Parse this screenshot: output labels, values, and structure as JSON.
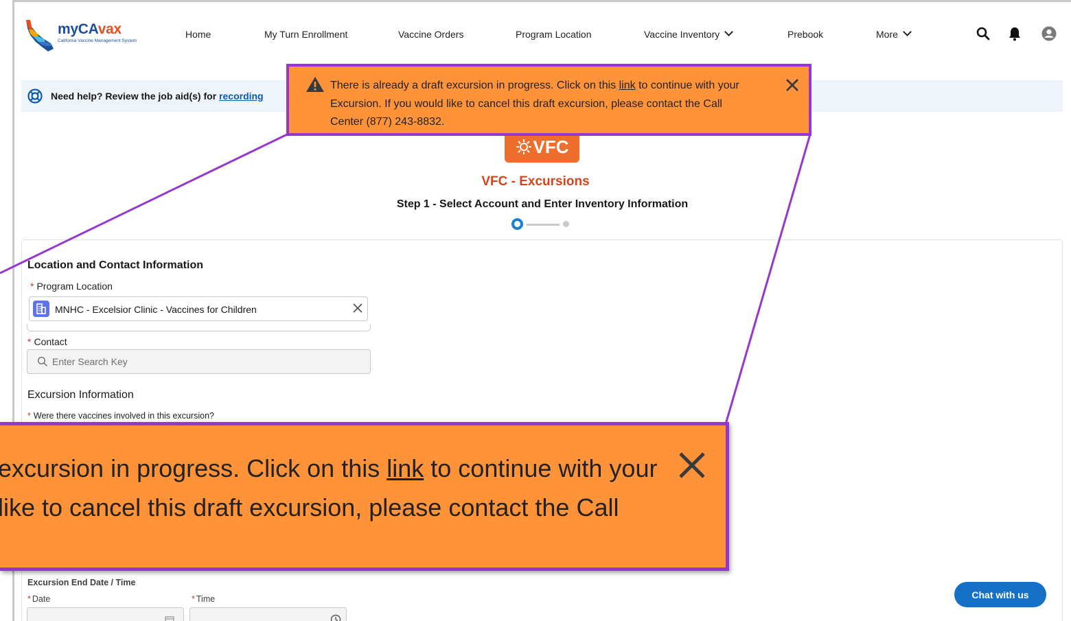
{
  "header": {
    "logo": {
      "brand_main": "myCA",
      "brand_accent": "vax",
      "subtitle": "California Vaccine Management System"
    },
    "nav": [
      {
        "label": "Home"
      },
      {
        "label": "My Turn Enrollment"
      },
      {
        "label": "Vaccine Orders"
      },
      {
        "label": "Program Location"
      },
      {
        "label": "Vaccine Inventory"
      },
      {
        "label": "Prebook"
      },
      {
        "label": "More"
      }
    ],
    "icons": [
      "search-icon",
      "bell-icon",
      "user-avatar-icon"
    ]
  },
  "help_bar": {
    "prefix": "Need help? Review the job aid(s) for ",
    "link": "recording"
  },
  "badge": {
    "text": "VFC"
  },
  "page": {
    "title": "VFC - Excursions",
    "step_title": "Step 1 - Select Account and Enter Inventory Information",
    "step": {
      "current": 1,
      "total": 2
    }
  },
  "form": {
    "section_title": "Location and Contact Information",
    "program_location_label": "Program Location",
    "program_location_value": "MNHC - Excelsior Clinic - Vaccines for Children",
    "contact_label": "Contact",
    "contact_placeholder": "Enter Search Key",
    "excursion_info_title": "Excursion Information",
    "vaccines_question": "Were there vaccines involved in this excursion?",
    "end_datetime_label": "Excursion End Date / Time",
    "date_label": "Date",
    "time_label": "Time",
    "required_marker": "*"
  },
  "toast": {
    "line1_before": "There is already a draft excursion in progress. Click on this ",
    "link": "link",
    "line1_after": " to continue with your",
    "line2": "Excursion. If you would like to cancel this draft excursion, please contact the Call",
    "line3": "Center (877) 243-8832."
  },
  "toast_zoom": {
    "line1_before": "excursion in progress. Click on this ",
    "link": "link",
    "line1_after": " to continue with your",
    "line2": " like to cancel this draft excursion, please contact the Call"
  },
  "chat": {
    "label": "Chat with us"
  },
  "colors": {
    "toast_bg": "#fe9339",
    "callout_border": "#9536d1",
    "title_orange": "#d2451e",
    "brand_blue": "#1b4e9b",
    "chat_blue": "#1570c8"
  }
}
